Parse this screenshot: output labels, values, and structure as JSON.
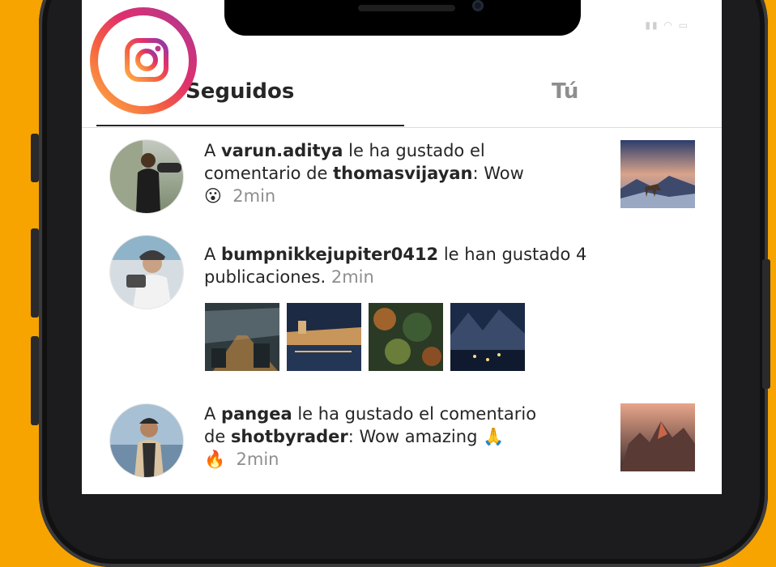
{
  "tabs": {
    "following": "Seguidos",
    "you": "Tú"
  },
  "notifications": [
    {
      "prefix": "A ",
      "user": "varun.aditya",
      "middle": " le ha gustado el",
      "line2_prefix": "comentario de ",
      "user2": "thomasvijayan",
      "comment": ": Wow",
      "emoji": "😮",
      "time": "2min"
    },
    {
      "prefix": "A ",
      "user": "bumpnikkejupiter0412",
      "middle": " le han gustado 4",
      "line2": "publicaciones.",
      "time": "2min"
    },
    {
      "prefix": "A ",
      "user": "pangea",
      "middle": " le ha gustado el comentario",
      "line2_prefix": "de ",
      "user2": "shotbyrader",
      "comment": ": Wow amazing 🙏",
      "emoji": "🔥",
      "time": "2min"
    }
  ],
  "colors": {
    "background": "#F7A400",
    "text": "#262626",
    "secondary_text": "#8e8e8e"
  },
  "icons": {
    "logo": "instagram-logo-icon"
  }
}
